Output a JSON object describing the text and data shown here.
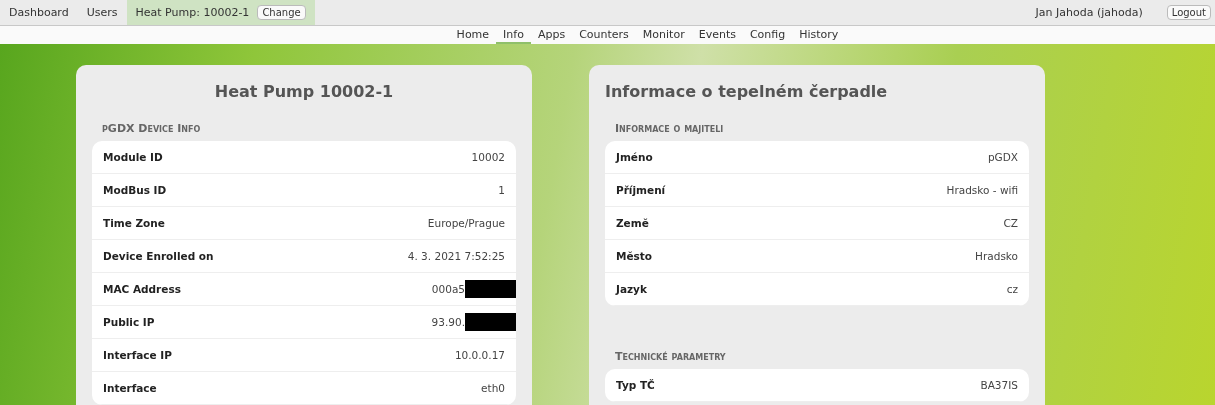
{
  "top_bar": {
    "links": [
      {
        "label": "Dashboard",
        "selected": false
      },
      {
        "label": "Users",
        "selected": false
      },
      {
        "label": "Heat Pump: 10002-1",
        "selected": true
      }
    ],
    "change_button": "Change",
    "user": "Jan Jahoda (jahoda)",
    "logout_button": "Logout"
  },
  "nav": [
    {
      "label": "Home",
      "selected": false
    },
    {
      "label": "Info",
      "selected": true
    },
    {
      "label": "Apps",
      "selected": false
    },
    {
      "label": "Counters",
      "selected": false
    },
    {
      "label": "Monitor",
      "selected": false
    },
    {
      "label": "Events",
      "selected": false
    },
    {
      "label": "Config",
      "selected": false
    },
    {
      "label": "History",
      "selected": false
    }
  ],
  "cards": [
    {
      "title": "Heat Pump 10002-1",
      "sections": [
        {
          "heading": "pGDX Device Info",
          "rows": [
            {
              "label": "Module ID",
              "value": "10002",
              "redacted": false
            },
            {
              "label": "ModBus ID",
              "value": "1",
              "redacted": false
            },
            {
              "label": "Time Zone",
              "value": "Europe/Prague",
              "redacted": false
            },
            {
              "label": "Device Enrolled on",
              "value": "4. 3. 2021 7:52:25",
              "redacted": false
            },
            {
              "label": "MAC Address",
              "value": "000a5",
              "redacted": true
            },
            {
              "label": "Public IP",
              "value": "93.90.",
              "redacted": true
            },
            {
              "label": "Interface IP",
              "value": "10.0.0.17",
              "redacted": false
            },
            {
              "label": "Interface",
              "value": "eth0",
              "redacted": false
            }
          ]
        }
      ]
    },
    {
      "title": "Informace o tepelném čerpadle",
      "sections": [
        {
          "heading": "Informace o majiteli",
          "rows": [
            {
              "label": "Jméno",
              "value": "pGDX",
              "redacted": false
            },
            {
              "label": "Příjmení",
              "value": "Hradsko - wifi",
              "redacted": false
            },
            {
              "label": "Země",
              "value": "CZ",
              "redacted": false
            },
            {
              "label": "Město",
              "value": "Hradsko",
              "redacted": false
            },
            {
              "label": "Jazyk",
              "value": "cz",
              "redacted": false
            }
          ]
        },
        {
          "heading": "Technické parametry",
          "rows": [
            {
              "label": "Typ TČ",
              "value": "BA37IS",
              "redacted": false
            }
          ]
        }
      ]
    }
  ]
}
